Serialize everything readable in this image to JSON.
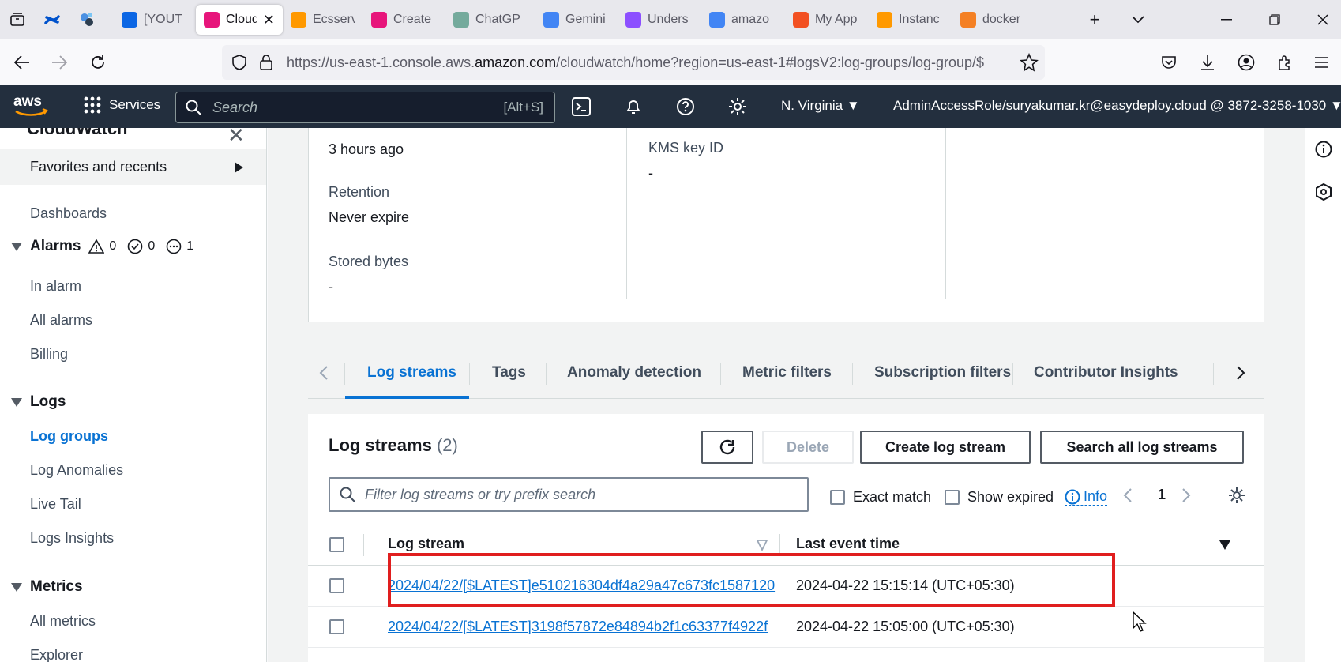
{
  "browser": {
    "tabs": [
      {
        "label": "[YOUT",
        "color": "#0b66e4"
      },
      {
        "label": "Cloud",
        "color": "#e7157b",
        "active": true
      },
      {
        "label": "Ecsserv",
        "color": "#ff9900"
      },
      {
        "label": "Create",
        "color": "#e7157b"
      },
      {
        "label": "ChatGP",
        "color": "#74aa9c"
      },
      {
        "label": "Gemini",
        "color": "#4285f4"
      },
      {
        "label": "Unders",
        "color": "#8c4fff"
      },
      {
        "label": "amazo",
        "color": "#4285f4"
      },
      {
        "label": "My App",
        "color": "#f25022"
      },
      {
        "label": "Instanc",
        "color": "#ff9900"
      },
      {
        "label": "docker",
        "color": "#f48024"
      }
    ],
    "url_prefix": "https://us-east-1.console.aws.",
    "url_domain": "amazon.com",
    "url_rest": "/cloudwatch/home?region=us-east-1#logsV2:log-groups/log-group/$"
  },
  "aws_header": {
    "services_label": "Services",
    "search_placeholder": "Search",
    "search_shortcut": "[Alt+S]",
    "region": "N. Virginia",
    "account": "AdminAccessRole/suryakumar.kr@easydeploy.cloud @ 3872-3258-1030"
  },
  "sidenav": {
    "title": "CloudWatch",
    "favorites": "Favorites and recents",
    "dashboards": "Dashboards",
    "alarms": {
      "label": "Alarms",
      "in_alarm_count": "0",
      "ok_count": "0",
      "insufficient_count": "1"
    },
    "alarm_items": [
      "In alarm",
      "All alarms",
      "Billing"
    ],
    "logs": "Logs",
    "log_items": [
      "Log groups",
      "Log Anomalies",
      "Live Tail",
      "Logs Insights"
    ],
    "metrics": "Metrics",
    "metric_items": [
      "All metrics",
      "Explorer"
    ]
  },
  "details": {
    "creation_value": "3 hours ago",
    "retention_label": "Retention",
    "retention_value": "Never expire",
    "stored_label": "Stored bytes",
    "stored_value": "-",
    "kms_label": "KMS key ID",
    "kms_value": "-"
  },
  "tabs": [
    "Log streams",
    "Tags",
    "Anomaly detection",
    "Metric filters",
    "Subscription filters",
    "Contributor Insights"
  ],
  "streams": {
    "title": "Log streams",
    "count": "(2)",
    "delete_label": "Delete",
    "create_label": "Create log stream",
    "search_all_label": "Search all log streams",
    "filter_placeholder": "Filter log streams or try prefix search",
    "exact_match": "Exact match",
    "show_expired": "Show expired",
    "info": "Info",
    "page": "1",
    "col_stream": "Log stream",
    "col_time": "Last event time",
    "rows": [
      {
        "name": "2024/04/22/[$LATEST]e510216304df4a29a47c673fc1587120",
        "time": "2024-04-22 15:15:14 (UTC+05:30)"
      },
      {
        "name": "2024/04/22/[$LATEST]3198f57872e84894b2f1c63377f4922f",
        "time": "2024-04-22 15:05:00 (UTC+05:30)"
      }
    ]
  }
}
